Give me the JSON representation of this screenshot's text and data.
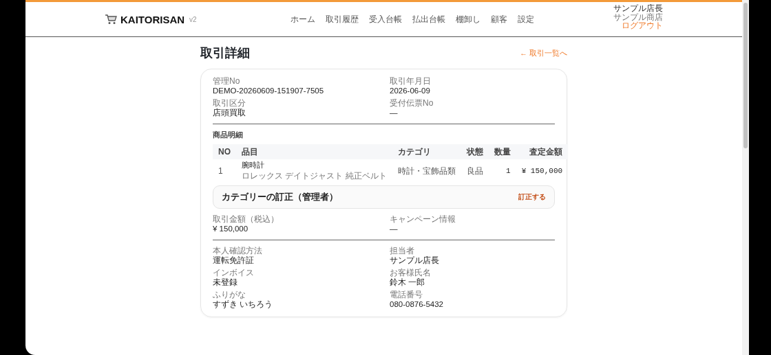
{
  "header": {
    "logo": "KAITORISAN",
    "version": "v2",
    "nav": [
      {
        "label": "ホーム",
        "selected": false
      },
      {
        "label": "取引履歴",
        "selected": false
      },
      {
        "label": "受入台帳",
        "selected": false
      },
      {
        "label": "払出台帳",
        "selected": false
      },
      {
        "label": "棚卸し",
        "selected": false
      },
      {
        "label": "顧客",
        "selected": false
      },
      {
        "label": "設定",
        "selected": false
      }
    ],
    "user": {
      "name": "サンプル店長",
      "shop": "サンプル商店",
      "logout": "ログアウト"
    }
  },
  "page": {
    "title": "取引詳細",
    "back_link": "← 取引一覧へ"
  },
  "summary": [
    {
      "label": "管理No",
      "value": "DEMO-20260609-151907-7505"
    },
    {
      "label": "取引年月日",
      "value": "2026-06-09"
    },
    {
      "label": "取引区分",
      "value": "店頭買取"
    },
    {
      "label": "受付伝票No",
      "value": "—"
    }
  ],
  "items": {
    "title": "商品明細",
    "columns": [
      "NO",
      "品目",
      "カテゴリ",
      "状態",
      "数量",
      "査定金額"
    ],
    "rows": [
      {
        "no": "1",
        "name": "腕時計",
        "detail": "ロレックス デイトジャスト 純正ベルト",
        "category": "時計・宝飾品類",
        "condition": "良品",
        "quantity": "1",
        "amount": "¥ 150,000"
      }
    ]
  },
  "correction": {
    "title": "カテゴリーの訂正（管理者）",
    "action": "訂正する"
  },
  "totals": [
    {
      "label": "取引金額（税込）",
      "value": "¥ 150,000"
    },
    {
      "label": "キャンペーン情報",
      "value": "—"
    }
  ],
  "customer": [
    {
      "label": "本人確認方法",
      "value": "運転免許証"
    },
    {
      "label": "担当者",
      "value": "サンプル店長"
    },
    {
      "label": "インボイス",
      "value": "未登録"
    },
    {
      "label": "お客様氏名",
      "value": "鈴木 一郎"
    },
    {
      "label": "ふりがな",
      "value": "すずき いちろう"
    },
    {
      "label": "電話番号",
      "value": "080-0876-5432"
    }
  ]
}
